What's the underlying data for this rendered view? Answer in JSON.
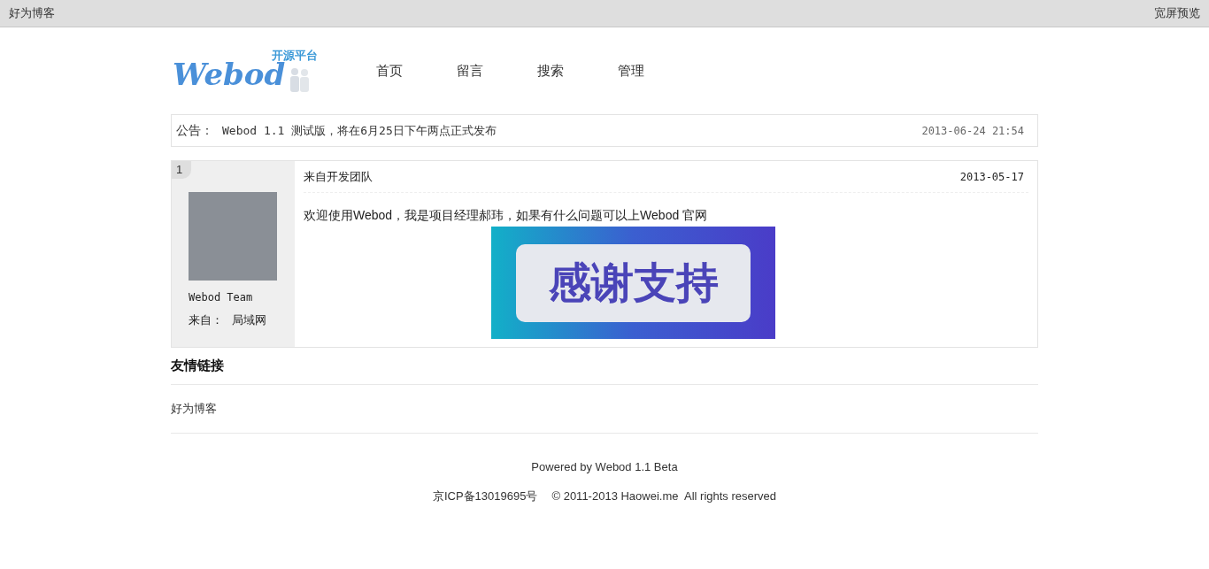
{
  "top_bar": {
    "site_name": "好为博客",
    "wide_preview": "宽屏预览"
  },
  "logo": {
    "wordmark": "Webod",
    "tagline": "开源平台"
  },
  "nav": [
    {
      "label": "首页"
    },
    {
      "label": "留言"
    },
    {
      "label": "搜索"
    },
    {
      "label": "管理"
    }
  ],
  "notice": {
    "label": "公告：",
    "text": "Webod 1.1 测试版，将在6月25日下午两点正式发布",
    "time": "2013-06-24 21:54"
  },
  "posts": [
    {
      "number": "1",
      "author": "Webod Team",
      "from_label": "来自：",
      "from": "局域网",
      "title": "来自开发团队",
      "date": "2013-05-17",
      "body": "欢迎使用Webod，我是项目经理郝玮，如果有什么问题可以上Webod 官网",
      "banner": "感谢支持"
    }
  ],
  "links": {
    "heading": "友情链接",
    "items": [
      "好为博客"
    ]
  },
  "footer": {
    "powered": "Powered by Webod 1.1 Beta",
    "icp": "京ICP备13019695号",
    "copyright": "© 2011-2013 Haowei.me  All rights reserved"
  }
}
